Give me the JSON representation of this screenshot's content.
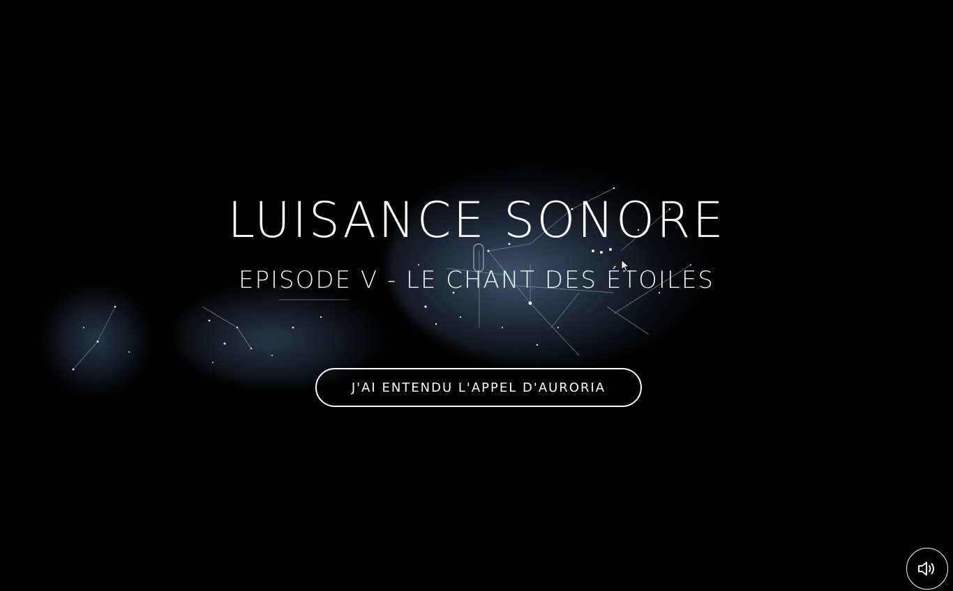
{
  "hero": {
    "title": "LUISANCE SONORE",
    "subtitle": "EPISODE V - LE CHANT DES ÉTOILES",
    "cta_label": "J'AI ENTENDU L'APPEL D'AURORIA"
  },
  "controls": {
    "sound_icon": "speaker-volume-icon"
  },
  "colors": {
    "background": "#000000",
    "text": "#ffffff",
    "nebula": "#4a627e"
  }
}
